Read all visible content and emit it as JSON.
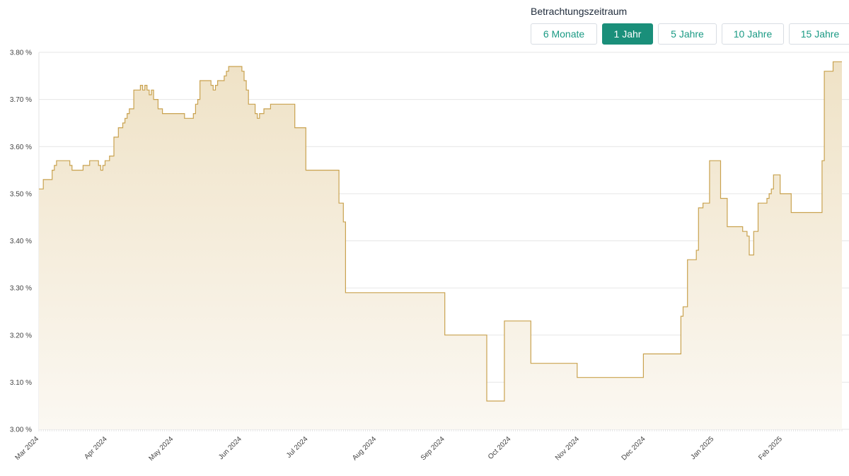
{
  "header": {
    "period_label": "Betrachtungszeitraum",
    "buttons": [
      {
        "label": "6 Monate",
        "active": false
      },
      {
        "label": "1 Jahr",
        "active": true
      },
      {
        "label": "5 Jahre",
        "active": false
      },
      {
        "label": "10 Jahre",
        "active": false
      },
      {
        "label": "15 Jahre",
        "active": false
      }
    ]
  },
  "colors": {
    "line": "#c9a24f",
    "fill_top": "#efe2c6",
    "fill_bottom": "#fbf8f2",
    "grid": "#e6e6e6",
    "accent": "#1a8f7a"
  },
  "chart_data": {
    "type": "area",
    "title": "",
    "xlabel": "",
    "ylabel": "",
    "ylim": [
      3.0,
      3.8
    ],
    "y_ticks": [
      3.0,
      3.1,
      3.2,
      3.3,
      3.4,
      3.5,
      3.6,
      3.7,
      3.8
    ],
    "y_tick_labels": [
      "3.00 %",
      "3.10 %",
      "3.20 %",
      "3.30 %",
      "3.40 %",
      "3.50 %",
      "3.60 %",
      "3.70 %",
      "3.80 %"
    ],
    "xlim": [
      "2024-03-01",
      "2025-02-28"
    ],
    "x_tick_labels": [
      "Mar 2024",
      "Apr 2024",
      "May 2024",
      "Jun 2024",
      "Jul 2024",
      "Aug 2024",
      "Sep 2024",
      "Oct 2024",
      "Nov 2024",
      "Dec 2024",
      "Jan 2025",
      "Feb 2025"
    ],
    "x_tick_dates": [
      "2024-03-01",
      "2024-04-01",
      "2024-05-01",
      "2024-06-01",
      "2024-07-01",
      "2024-08-01",
      "2024-09-01",
      "2024-10-01",
      "2024-11-01",
      "2024-12-01",
      "2025-01-01",
      "2025-02-01"
    ],
    "grid": true,
    "step": true,
    "series": [
      {
        "x": [
          "2024-03-01",
          "2024-03-03",
          "2024-03-07",
          "2024-03-08",
          "2024-03-09",
          "2024-03-10",
          "2024-03-15",
          "2024-03-16",
          "2024-03-17",
          "2024-03-21",
          "2024-03-24",
          "2024-03-28",
          "2024-03-29",
          "2024-03-30",
          "2024-03-31",
          "2024-04-02",
          "2024-04-04",
          "2024-04-06",
          "2024-04-07",
          "2024-04-08",
          "2024-04-09",
          "2024-04-10",
          "2024-04-11",
          "2024-04-13",
          "2024-04-14",
          "2024-04-16",
          "2024-04-17",
          "2024-04-18",
          "2024-04-19",
          "2024-04-20",
          "2024-04-21",
          "2024-04-22",
          "2024-04-23",
          "2024-04-24",
          "2024-04-26",
          "2024-04-27",
          "2024-04-28",
          "2024-05-06",
          "2024-05-10",
          "2024-05-11",
          "2024-05-12",
          "2024-05-13",
          "2024-05-14",
          "2024-05-18",
          "2024-05-19",
          "2024-05-20",
          "2024-05-21",
          "2024-05-24",
          "2024-05-25",
          "2024-05-26",
          "2024-05-27",
          "2024-06-01",
          "2024-06-02",
          "2024-06-03",
          "2024-06-04",
          "2024-06-07",
          "2024-06-08",
          "2024-06-09",
          "2024-06-11",
          "2024-06-14",
          "2024-06-25",
          "2024-06-30",
          "2024-07-15",
          "2024-07-17",
          "2024-07-18",
          "2024-09-01",
          "2024-09-20",
          "2024-09-28",
          "2024-10-10",
          "2024-10-31",
          "2024-11-30",
          "2024-12-17",
          "2024-12-18",
          "2024-12-20",
          "2024-12-24",
          "2024-12-25",
          "2024-12-27",
          "2024-12-30",
          "2025-01-04",
          "2025-01-07",
          "2025-01-14",
          "2025-01-16",
          "2025-01-17",
          "2025-01-18",
          "2025-01-19",
          "2025-01-21",
          "2025-01-25",
          "2025-01-26",
          "2025-01-27",
          "2025-01-28",
          "2025-01-31",
          "2025-02-01",
          "2025-02-05",
          "2025-02-13",
          "2025-02-19",
          "2025-02-20",
          "2025-02-24"
        ],
        "values": [
          3.51,
          3.53,
          3.55,
          3.56,
          3.57,
          3.57,
          3.56,
          3.55,
          3.55,
          3.56,
          3.57,
          3.56,
          3.55,
          3.56,
          3.57,
          3.58,
          3.62,
          3.64,
          3.64,
          3.65,
          3.66,
          3.67,
          3.68,
          3.72,
          3.72,
          3.73,
          3.72,
          3.73,
          3.72,
          3.71,
          3.72,
          3.7,
          3.7,
          3.68,
          3.67,
          3.67,
          3.67,
          3.66,
          3.67,
          3.69,
          3.7,
          3.74,
          3.74,
          3.73,
          3.72,
          3.73,
          3.74,
          3.75,
          3.76,
          3.77,
          3.77,
          3.76,
          3.74,
          3.72,
          3.69,
          3.67,
          3.66,
          3.67,
          3.68,
          3.69,
          3.64,
          3.55,
          3.48,
          3.44,
          3.29,
          3.2,
          3.06,
          3.23,
          3.14,
          3.11,
          3.16,
          3.24,
          3.26,
          3.36,
          3.38,
          3.47,
          3.48,
          3.57,
          3.49,
          3.43,
          3.42,
          3.41,
          3.37,
          3.37,
          3.42,
          3.48,
          3.49,
          3.5,
          3.51,
          3.54,
          3.5,
          3.5,
          3.46,
          3.46,
          3.57,
          3.76,
          3.78
        ],
        "end": "2025-02-28"
      }
    ]
  }
}
